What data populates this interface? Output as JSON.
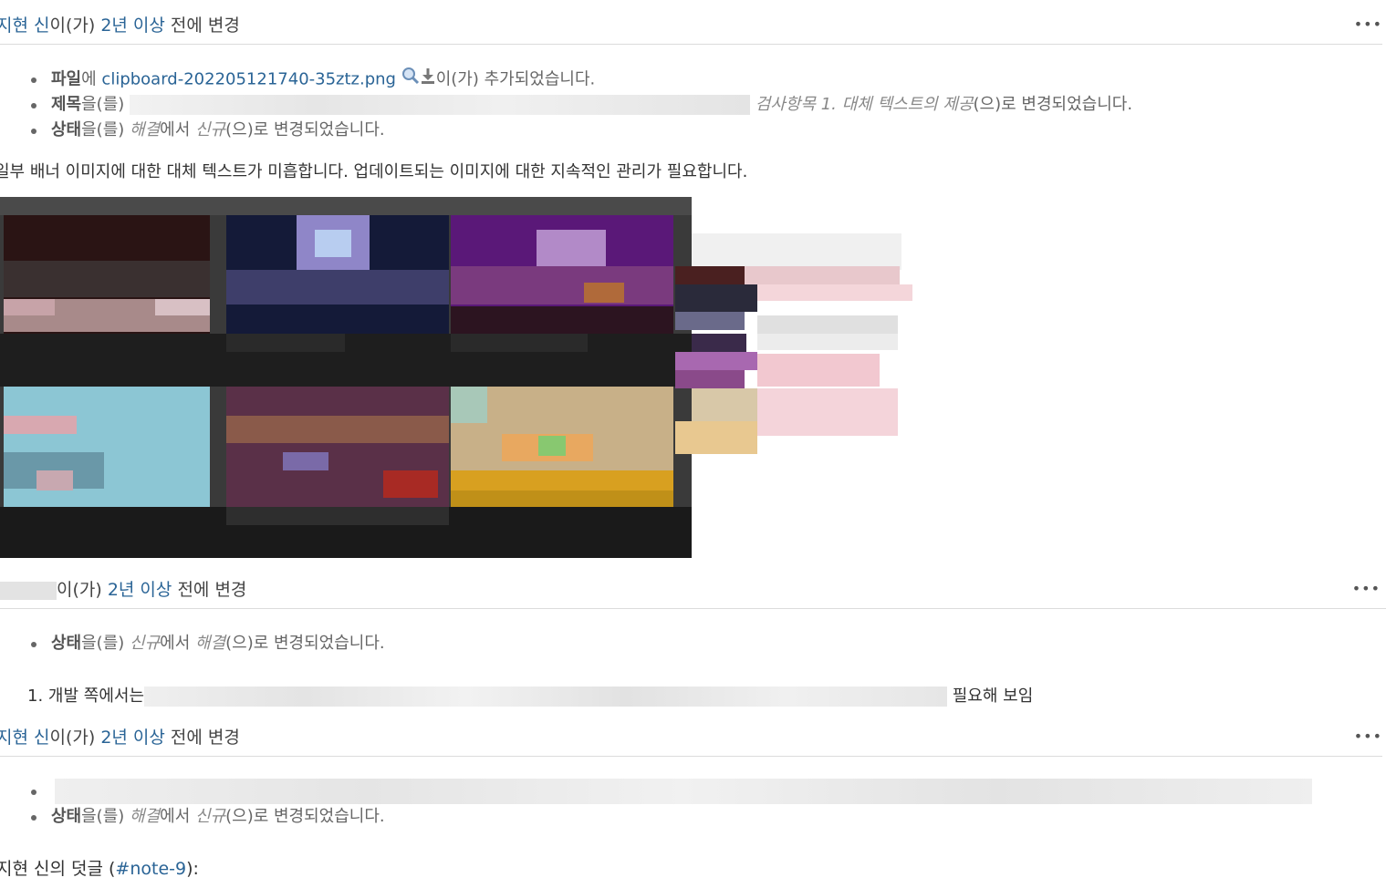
{
  "journals": [
    {
      "author_link": "지현 신",
      "suffix": "이(가) ",
      "time_link": "2년 이상",
      "time_suffix": " 전에 변경",
      "more_icon": "ellipsis-icon"
    },
    {
      "author_link": "",
      "suffix": "이(가) ",
      "time_link": "2년 이상",
      "time_suffix": " 전에 변경",
      "more_icon": "ellipsis-icon"
    },
    {
      "author_link": "지현 신",
      "suffix": "이(가) ",
      "time_link": "2년 이상",
      "time_suffix": " 전에 변경",
      "more_icon": "ellipsis-icon"
    }
  ],
  "j1_details": {
    "file_label": "파일",
    "file_mid": "에 ",
    "file_link": "clipboard-202205121740-35ztz.png",
    "file_suffix": "이(가) 추가되었습니다.",
    "title_label": "제목",
    "title_mid": "을(를) ",
    "title_new": "검사항목 1. 대체 텍스트의 제공",
    "title_suffix": "(으)로 변경되었습니다.",
    "status_label": "상태",
    "status_mid": "을(를) ",
    "status_old": "해결",
    "status_old_suffix": "에서 ",
    "status_new": "신규",
    "status_suffix": "(으)로 변경되었습니다."
  },
  "j1_note": "일부 배너 이미지에 대한 대체 텍스트가 미흡합니다. 업데이트되는 이미지에 대한 지속적인 관리가 필요합니다.",
  "j2_details": {
    "status_label": "상태",
    "status_mid": "을(를) ",
    "status_old": "신규",
    "status_old_suffix": "에서 ",
    "status_new": "해결",
    "status_suffix": "(으)로 변경되었습니다."
  },
  "j2_note": {
    "number": "1.",
    "prefix": "개발 쪽에서는",
    "suffix": "필요해 보임"
  },
  "j3_details": {
    "status_label": "상태",
    "status_mid": "을(를) ",
    "status_old": "해결",
    "status_old_suffix": "에서 ",
    "status_new": "신규",
    "status_suffix": "(으)로 변경되었습니다."
  },
  "comment_header": {
    "author": "지현 신",
    "text": "의 덧글 (",
    "note_link": "#note-9",
    "close": "):"
  },
  "icons": {
    "zoom": "magnifier-icon",
    "download": "download-icon"
  }
}
